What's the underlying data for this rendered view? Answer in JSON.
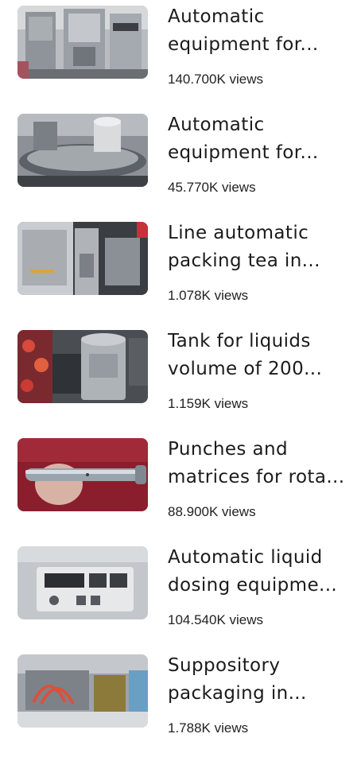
{
  "videos": [
    {
      "title_line1": "Automatic",
      "title_line2": "equipment for...",
      "views": "140.700K views",
      "thumbnail": "machine-thumbnail"
    },
    {
      "title_line1": "Automatic",
      "title_line2": "equipment for...",
      "views": "45.770K views",
      "thumbnail": "machine-thumbnail"
    },
    {
      "title_line1": "Line automatic",
      "title_line2": "packing tea in...",
      "views": "1.078K views",
      "thumbnail": "machine-thumbnail"
    },
    {
      "title_line1": "Tank for liquids",
      "title_line2": "volume of 200...",
      "views": "1.159K views",
      "thumbnail": "tank-thumbnail"
    },
    {
      "title_line1": "Punches and",
      "title_line2": "matrices for rota...",
      "views": "88.900K views",
      "thumbnail": "punch-thumbnail"
    },
    {
      "title_line1": "Automatic liquid",
      "title_line2": "dosing equipme...",
      "views": "104.540K views",
      "thumbnail": "control-panel-thumbnail"
    },
    {
      "title_line1": "Suppository",
      "title_line2": "packaging in...",
      "views": "1.788K views",
      "thumbnail": "machine-thumbnail"
    }
  ]
}
